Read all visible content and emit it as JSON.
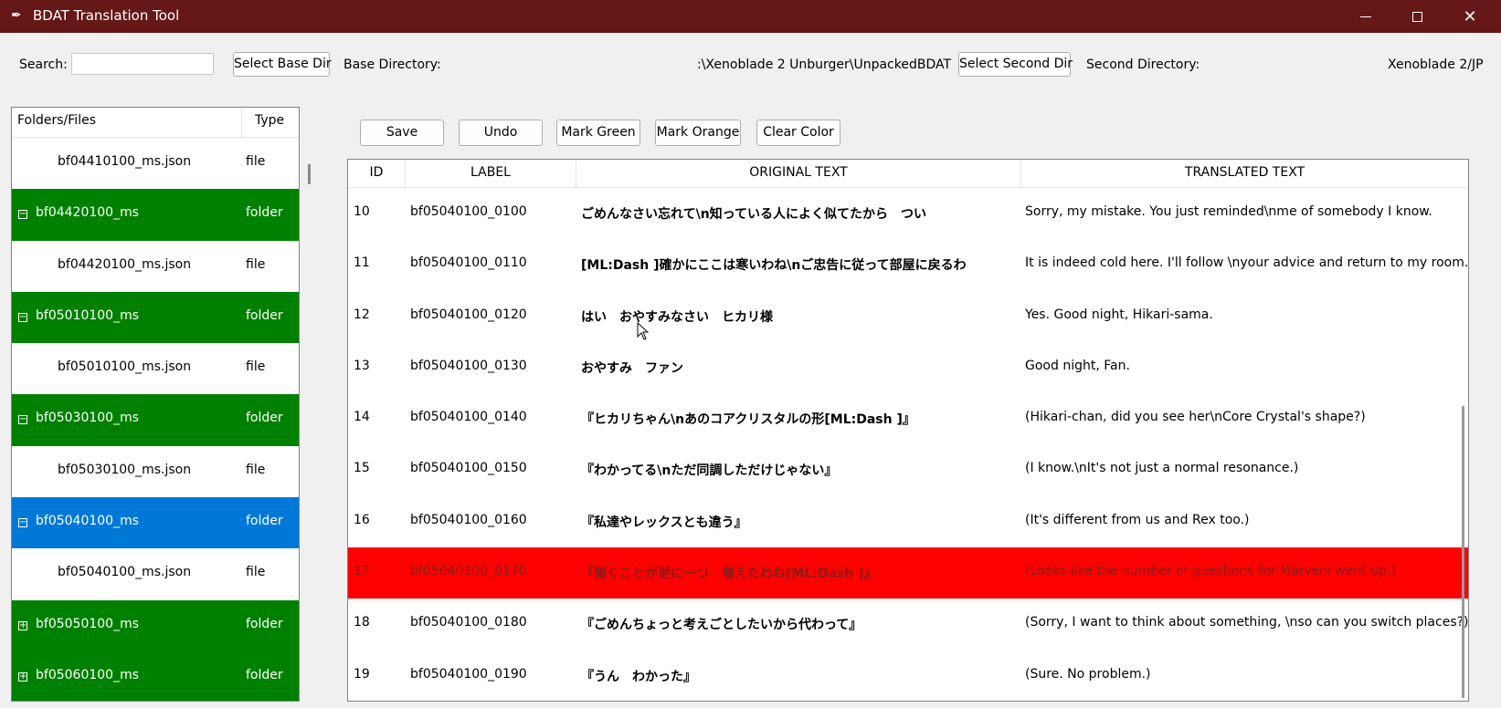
{
  "window": {
    "title": "BDAT Translation Tool"
  },
  "topbar": {
    "search_label": "Search:",
    "search_value": "",
    "select_base_dir": "Select Base Dir",
    "base_directory_label": "Base Directory:",
    "base_directory_value": ":\\Xenoblade 2 Unburger\\UnpackedBDAT",
    "select_second_dir": "Select Second Dir",
    "second_directory_label": "Second Directory: (",
    "second_directory_value": "Xenoblade 2/JP"
  },
  "toolbar": {
    "save": "Save",
    "undo": "Undo",
    "mark_green": "Mark Green",
    "mark_orange": "Mark Orange",
    "clear_color": "Clear Color"
  },
  "tree": {
    "col_name": "Folders/Files",
    "col_type": "Type",
    "rows": [
      {
        "name": "bf04410100_ms.json",
        "type": "file",
        "kind": "file"
      },
      {
        "name": "bf04420100_ms",
        "type": "folder",
        "kind": "folder",
        "toggle": "−"
      },
      {
        "name": "bf04420100_ms.json",
        "type": "file",
        "kind": "file"
      },
      {
        "name": "bf05010100_ms",
        "type": "folder",
        "kind": "folder",
        "toggle": "−"
      },
      {
        "name": "bf05010100_ms.json",
        "type": "file",
        "kind": "file"
      },
      {
        "name": "bf05030100_ms",
        "type": "folder",
        "kind": "folder",
        "toggle": "−"
      },
      {
        "name": "bf05030100_ms.json",
        "type": "file",
        "kind": "file"
      },
      {
        "name": "bf05040100_ms",
        "type": "folder",
        "kind": "selected",
        "toggle": "−"
      },
      {
        "name": "bf05040100_ms.json",
        "type": "file",
        "kind": "file"
      },
      {
        "name": "bf05050100_ms",
        "type": "folder",
        "kind": "folder",
        "toggle": "+"
      },
      {
        "name": "bf05060100_ms",
        "type": "folder",
        "kind": "folder",
        "toggle": "+"
      }
    ]
  },
  "table": {
    "headers": {
      "id": "ID",
      "label": "LABEL",
      "original": "ORIGINAL TEXT",
      "translated": "TRANSLATED TEXT"
    },
    "rows": [
      {
        "id": "10",
        "label": "bf05040100_0100",
        "original": "ごめんなさい忘れて\\n知っている人によく似てたから　つい",
        "translated": "Sorry, my mistake. You just reminded\\nme of somebody I know.",
        "highlight": ""
      },
      {
        "id": "11",
        "label": "bf05040100_0110",
        "original": "[ML:Dash ]確かにここは寒いわね\\nご忠告に従って部屋に戻るわ",
        "translated": "It is indeed cold here. I'll follow \\nyour advice and return to my room.",
        "highlight": ""
      },
      {
        "id": "12",
        "label": "bf05040100_0120",
        "original": "はい　おやすみなさい　ヒカリ様",
        "translated": "Yes. Good night, Hikari-sama.",
        "highlight": ""
      },
      {
        "id": "13",
        "label": "bf05040100_0130",
        "original": "おやすみ　ファン",
        "translated": "Good night, Fan.",
        "highlight": ""
      },
      {
        "id": "14",
        "label": "bf05040100_0140",
        "original": "『ヒカリちゃん\\nあのコアクリスタルの形[ML:Dash ]』",
        "translated": "(Hikari-chan, did you see her\\nCore Crystal's shape?)",
        "highlight": ""
      },
      {
        "id": "15",
        "label": "bf05040100_0150",
        "original": "『わかってる\\nただ同調しただけじゃない』",
        "translated": "(I know.\\nIt's not just a normal resonance.)",
        "highlight": ""
      },
      {
        "id": "16",
        "label": "bf05040100_0160",
        "original": "『私達やレックスとも違う』",
        "translated": "(It's different from us and Rex too.)",
        "highlight": ""
      },
      {
        "id": "17",
        "label": "bf05040100_0170",
        "original": "『聞くことが更に一つ　増えたわね[ML:Dash ]』",
        "translated": "(Looks like the number of questions for Marveni went up.)",
        "highlight": "red"
      },
      {
        "id": "18",
        "label": "bf05040100_0180",
        "original": "『ごめんちょっと考えごとしたいから代わって』",
        "translated": "(Sorry, I want to think about something, \\nso can you switch places?)",
        "highlight": ""
      },
      {
        "id": "19",
        "label": "bf05040100_0190",
        "original": "『うん　わかった』",
        "translated": "(Sure. No problem.)",
        "highlight": ""
      }
    ]
  },
  "colors": {
    "titlebar": "#661818",
    "folder_row": "#008000",
    "selected_row": "#0078d7",
    "marked_red": "#ff0000"
  }
}
